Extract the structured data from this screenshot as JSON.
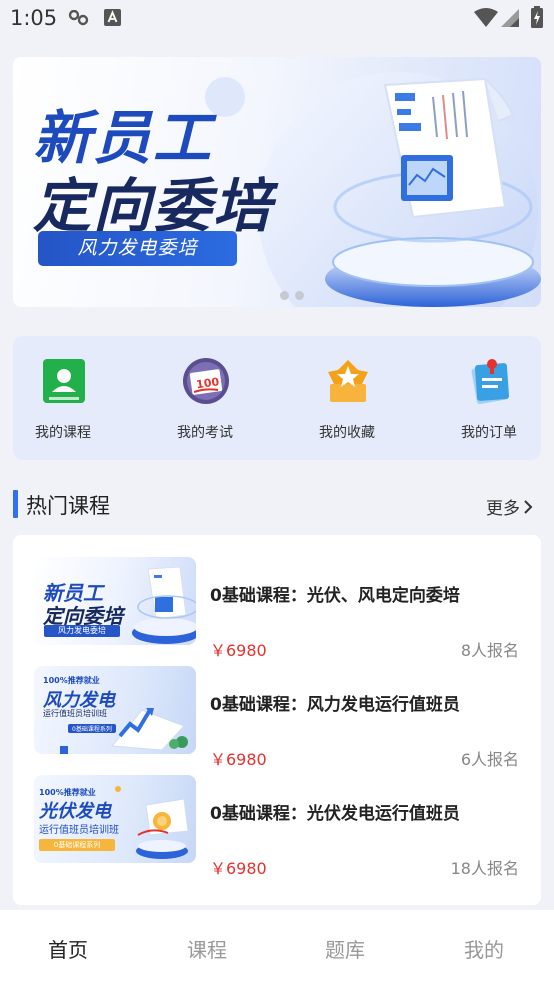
{
  "status": {
    "time": "1:05"
  },
  "banner": {
    "line1": "新员工",
    "line2": "定向委培",
    "tag": "风力发电委培",
    "page_count": 2,
    "active_page": 1
  },
  "quick_actions": [
    {
      "label": "我的课程",
      "icon": "course-book-icon",
      "color": "#22b04b"
    },
    {
      "label": "我的考试",
      "icon": "exam-score-icon",
      "color": "#5a4e8f"
    },
    {
      "label": "我的收藏",
      "icon": "favorite-star-icon",
      "color": "#f5a21b"
    },
    {
      "label": "我的订单",
      "icon": "order-doc-icon",
      "color": "#3aa0e4"
    }
  ],
  "hot_courses": {
    "title": "热门课程",
    "more": "更多",
    "items": [
      {
        "title": "0基础课程：光伏、风电定向委培",
        "price": "￥6980",
        "enrolled": "8人报名",
        "thumb": {
          "line1": "新员工",
          "line2": "定向委培",
          "tag": "风力发电委培"
        }
      },
      {
        "title": "0基础课程：风力发电运行值班员",
        "price": "￥6980",
        "enrolled": "6人报名",
        "thumb": {
          "badge": "100%推荐就业",
          "line1": "风力发电",
          "line2": "运行值班员培训班",
          "tag": "0基础课程系列"
        }
      },
      {
        "title": "0基础课程：光伏发电运行值班员",
        "price": "￥6980",
        "enrolled": "18人报名",
        "thumb": {
          "badge": "100%推荐就业",
          "line1": "光伏发电",
          "line2": "运行值班员培训班",
          "tag": "0基础课程系列"
        }
      }
    ]
  },
  "tabbar": {
    "tabs": [
      "首页",
      "课程",
      "题库",
      "我的"
    ],
    "active": 0
  }
}
